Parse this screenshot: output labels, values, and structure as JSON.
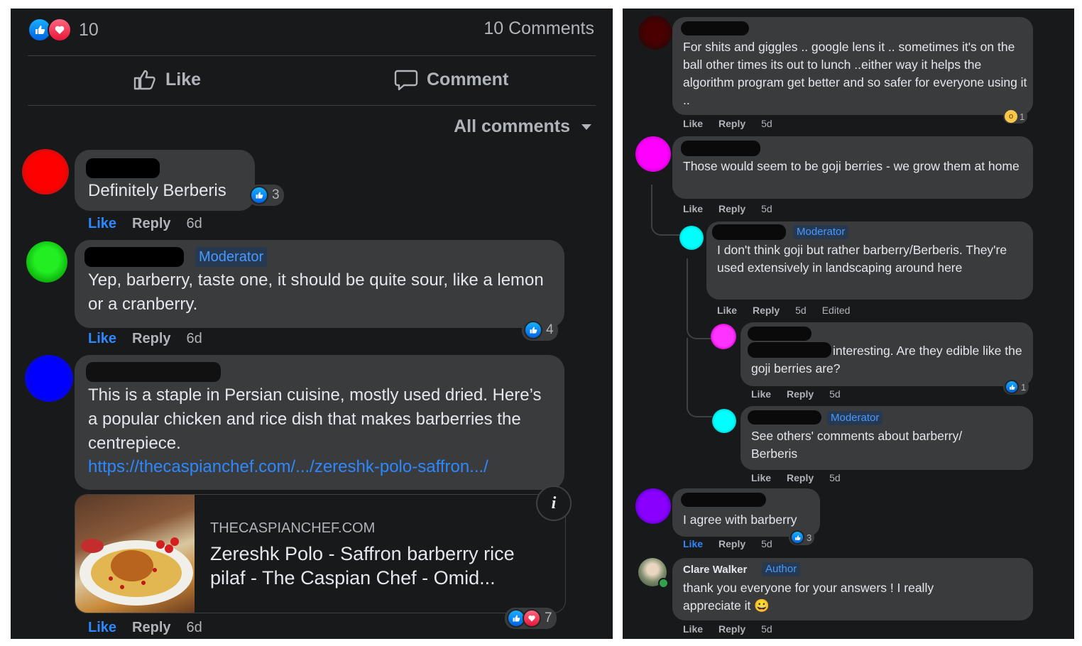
{
  "left": {
    "reactions_count": "10",
    "comments_count": "10 Comments",
    "like_label": "Like",
    "comment_label": "Comment",
    "sort_label": "All comments",
    "comments": [
      {
        "text": "Definitely Berberis",
        "reactions": "3",
        "like": "Like",
        "reply": "Reply",
        "time": "6d"
      },
      {
        "badge": "Moderator",
        "text": "Yep, barberry, taste one, it should be quite sour, like a lemon or a cranberry.",
        "reactions": "4",
        "like": "Like",
        "reply": "Reply",
        "time": "6d"
      },
      {
        "text": "This is a staple in Persian cuisine, mostly used dried. Here’s a popular chicken and rice dish that makes barberries the centrepiece.",
        "link": "https://thecaspianchef.com/.../zereshk-polo-saffron.../",
        "preview_domain": "THECASPIANCHEF.COM",
        "preview_title": "Zereshk Polo - Saffron barberry rice pilaf - The Caspian Chef - Omid...",
        "info_icon": "i",
        "reactions": "7",
        "like": "Like",
        "reply": "Reply",
        "time": "6d"
      }
    ]
  },
  "right": {
    "comments": [
      {
        "text": "For shits and giggles .. google lens it .. sometimes it's on the ball other times its out to lunch ..either way it helps the algorithm program get better and so safer for everyone using it ..",
        "reactions": "1",
        "like": "Like",
        "reply": "Reply",
        "time": "5d"
      },
      {
        "text": "Those would seem to be goji berries - we grow them at home",
        "like": "Like",
        "reply": "Reply",
        "time": "5d"
      },
      {
        "badge": "Moderator",
        "text": "I don't think goji but rather barberry/Berberis. They're used extensively in landscaping around here",
        "like": "Like",
        "reply": "Reply",
        "time": "5d",
        "edited": "Edited"
      },
      {
        "text": "interesting. Are they edible like the goji berries are?",
        "reactions": "1",
        "like": "Like",
        "reply": "Reply",
        "time": "5d"
      },
      {
        "badge": "Moderator",
        "text": "See others' comments about barberry/ Berberis",
        "like": "Like",
        "reply": "Reply",
        "time": "5d"
      },
      {
        "text": "I agree with barberry",
        "reactions": "3",
        "like": "Like",
        "reply": "Reply",
        "time": "5d"
      },
      {
        "author": "Clare Walker",
        "badge": "Author",
        "text": "thank you everyone for your answers ! I really appreciate it 😀",
        "like": "Like",
        "reply": "Reply",
        "time": "5d"
      }
    ]
  },
  "colors": {
    "panel_bg": "#18191a",
    "bubble_bg": "#3a3b3c",
    "text": "#e4e6eb",
    "muted": "#b0b3b8",
    "accent_blue": "#2d88ff",
    "badge_bg": "#263951",
    "badge_text": "#4599ff"
  },
  "icons": [
    "like-reaction-icon",
    "love-reaction-icon",
    "thumbs-up-icon",
    "speech-bubble-icon",
    "dropdown-caret-icon",
    "info-icon",
    "wow-reaction-icon",
    "smile-emoji"
  ]
}
